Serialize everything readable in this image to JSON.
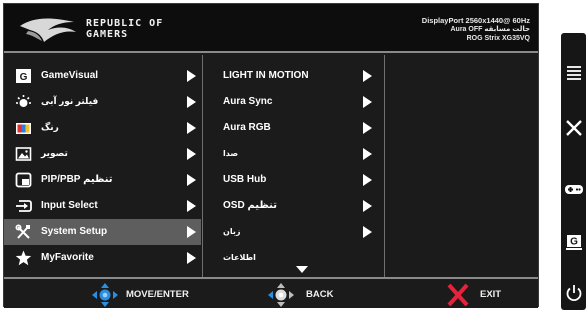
{
  "header": {
    "brand_line1": "REPUBLIC OF",
    "brand_line2": "GAMERS",
    "info_line1": "DisplayPort 2560x1440@ 60Hz",
    "info_line2": "Aura OFF حالت مسابقه",
    "info_line3": "ROG Strix XG35VQ"
  },
  "menu": {
    "items": [
      {
        "label": "GameVisual",
        "icon": "gamevisual-icon"
      },
      {
        "label": "فیلتر نور آبی",
        "icon": "blue-light-icon"
      },
      {
        "label": "رنگ",
        "icon": "color-icon"
      },
      {
        "label": "تصویر",
        "icon": "image-icon"
      },
      {
        "label": "PIP/PBP تنظیم",
        "icon": "pip-icon"
      },
      {
        "label": "Input Select",
        "icon": "input-select-icon"
      },
      {
        "label": "System Setup",
        "icon": "system-setup-icon",
        "selected": true
      },
      {
        "label": "MyFavorite",
        "icon": "star-icon"
      }
    ]
  },
  "submenu": {
    "items": [
      {
        "label": "LIGHT IN MOTION"
      },
      {
        "label": "Aura Sync"
      },
      {
        "label": "Aura RGB"
      },
      {
        "label": "صدا"
      },
      {
        "label": "USB Hub"
      },
      {
        "label": "OSD تنظیم"
      },
      {
        "label": "زبان"
      },
      {
        "label": "اطلاعات"
      }
    ]
  },
  "footer": {
    "move_label": "MOVE/ENTER",
    "back_label": "BACK",
    "exit_label": "EXIT"
  },
  "colors": {
    "background": "#1b1b1b",
    "selected_row": "#5e5e5e",
    "joystick_blue": "#2a8fe0",
    "exit_red": "#e6233a"
  }
}
